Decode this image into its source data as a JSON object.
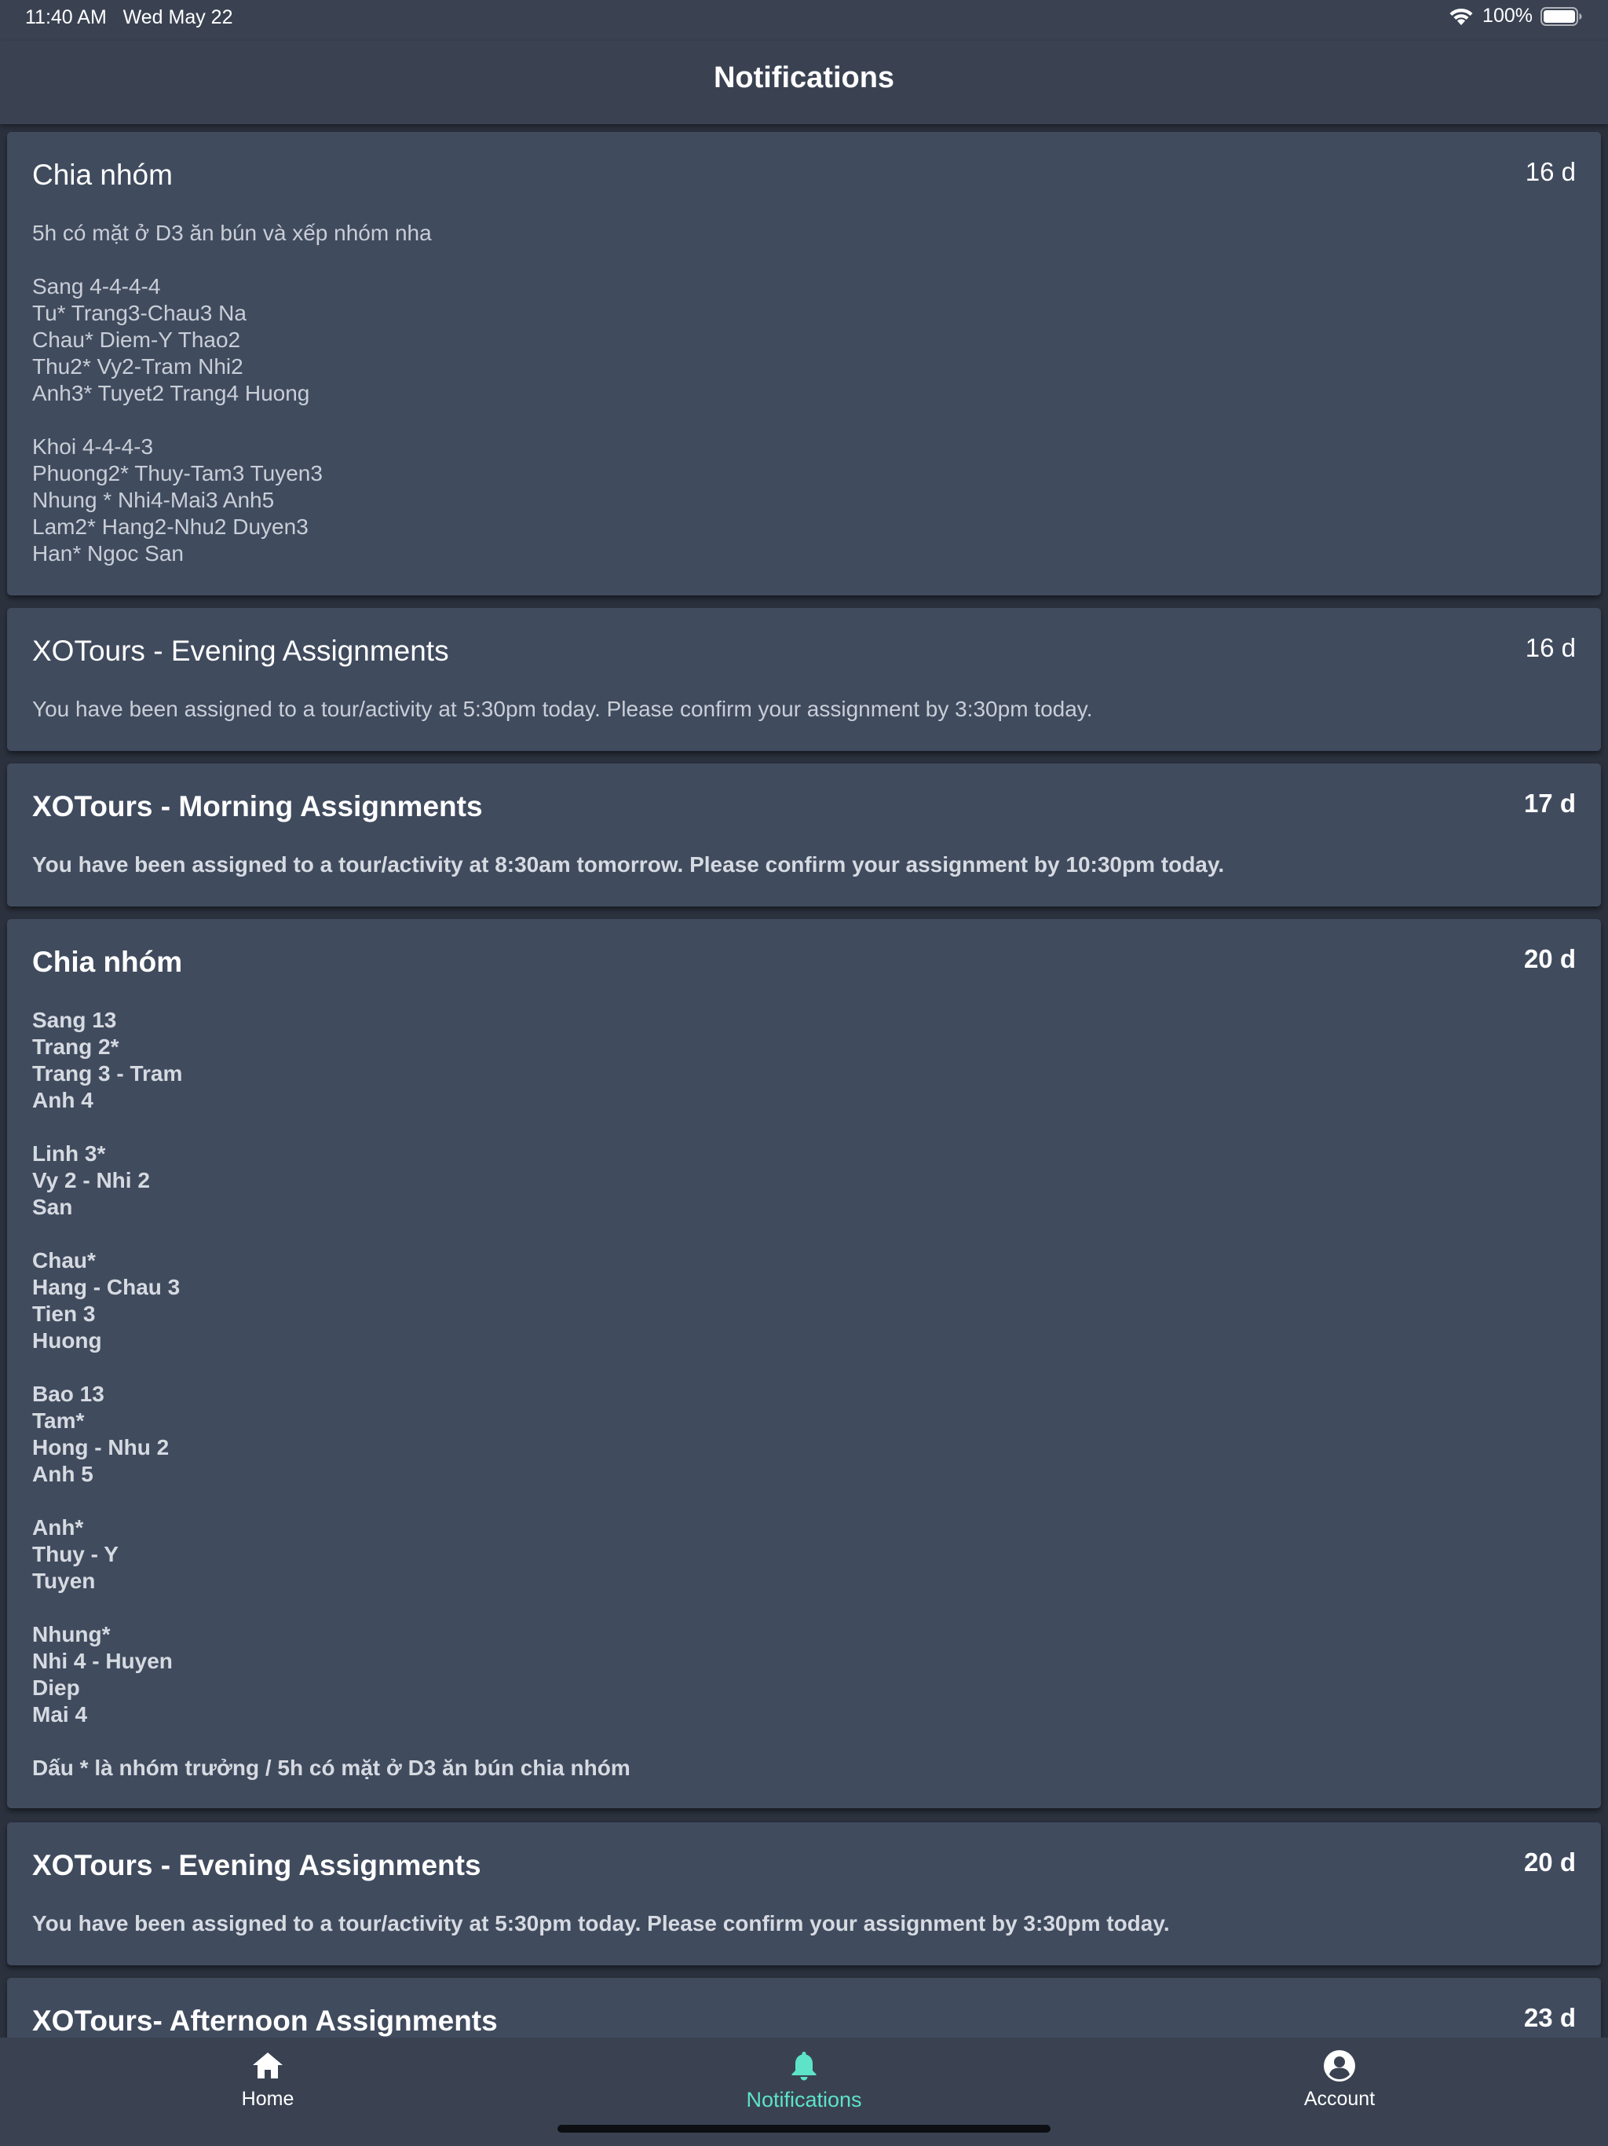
{
  "status_bar": {
    "time": "11:40 AM   Wed May 22",
    "battery": "100%"
  },
  "header": {
    "title": "Notifications"
  },
  "notifications": [
    {
      "title": "Chia nhóm",
      "age": "16 d",
      "body": "5h có mặt ở D3 ăn bún và xếp nhóm nha\n\nSang 4-4-4-4\nTu* Trang3-Chau3  Na\nChau*  Diem-Y  Thao2\nThu2* Vy2-Tram Nhi2\nAnh3*  Tuyet2   Trang4  Huong\n\nKhoi 4-4-4-3\nPhuong2* Thuy-Tam3 Tuyen3\nNhung *  Nhi4-Mai3  Anh5\nLam2*  Hang2-Nhu2  Duyen3\nHan*  Ngoc  San"
    },
    {
      "title": "XOTours - Evening Assignments",
      "age": "16 d",
      "body": "You have been assigned to a tour/activity at 5:30pm today. Please confirm your assignment by 3:30pm today."
    },
    {
      "title": "XOTours - Morning Assignments",
      "age": "17 d",
      "body": "You have been assigned to a tour/activity at 8:30am tomorrow. Please confirm your assignment by 10:30pm today."
    },
    {
      "title": "Chia nhóm",
      "age": "20 d",
      "body": "Sang 13\nTrang 2*\nTrang 3 - Tram\nAnh 4\n\nLinh 3*\nVy 2 - Nhi 2\nSan\n\nChau*\nHang - Chau 3\nTien 3\nHuong\n\nBao 13\nTam*\nHong - Nhu 2\nAnh 5\n\nAnh*\nThuy - Y\nTuyen\n\nNhung*\nNhi 4 - Huyen\nDiep\nMai 4\n\nDấu * là nhóm trưởng / 5h có mặt ở D3 ăn bún chia nhóm"
    },
    {
      "title": "XOTours - Evening Assignments",
      "age": "20 d",
      "body": "You have been assigned to a tour/activity at 5:30pm today. Please confirm your assignment by 3:30pm today."
    },
    {
      "title": "XOTours- Afternoon Assignments",
      "age": "23 d",
      "body": ""
    }
  ],
  "tabs": {
    "home": "Home",
    "notifications": "Notifications",
    "account": "Account"
  },
  "colors": {
    "active_tab": "#5de3c8",
    "card_background": "#404b5e",
    "bar_background": "#3a4252"
  }
}
